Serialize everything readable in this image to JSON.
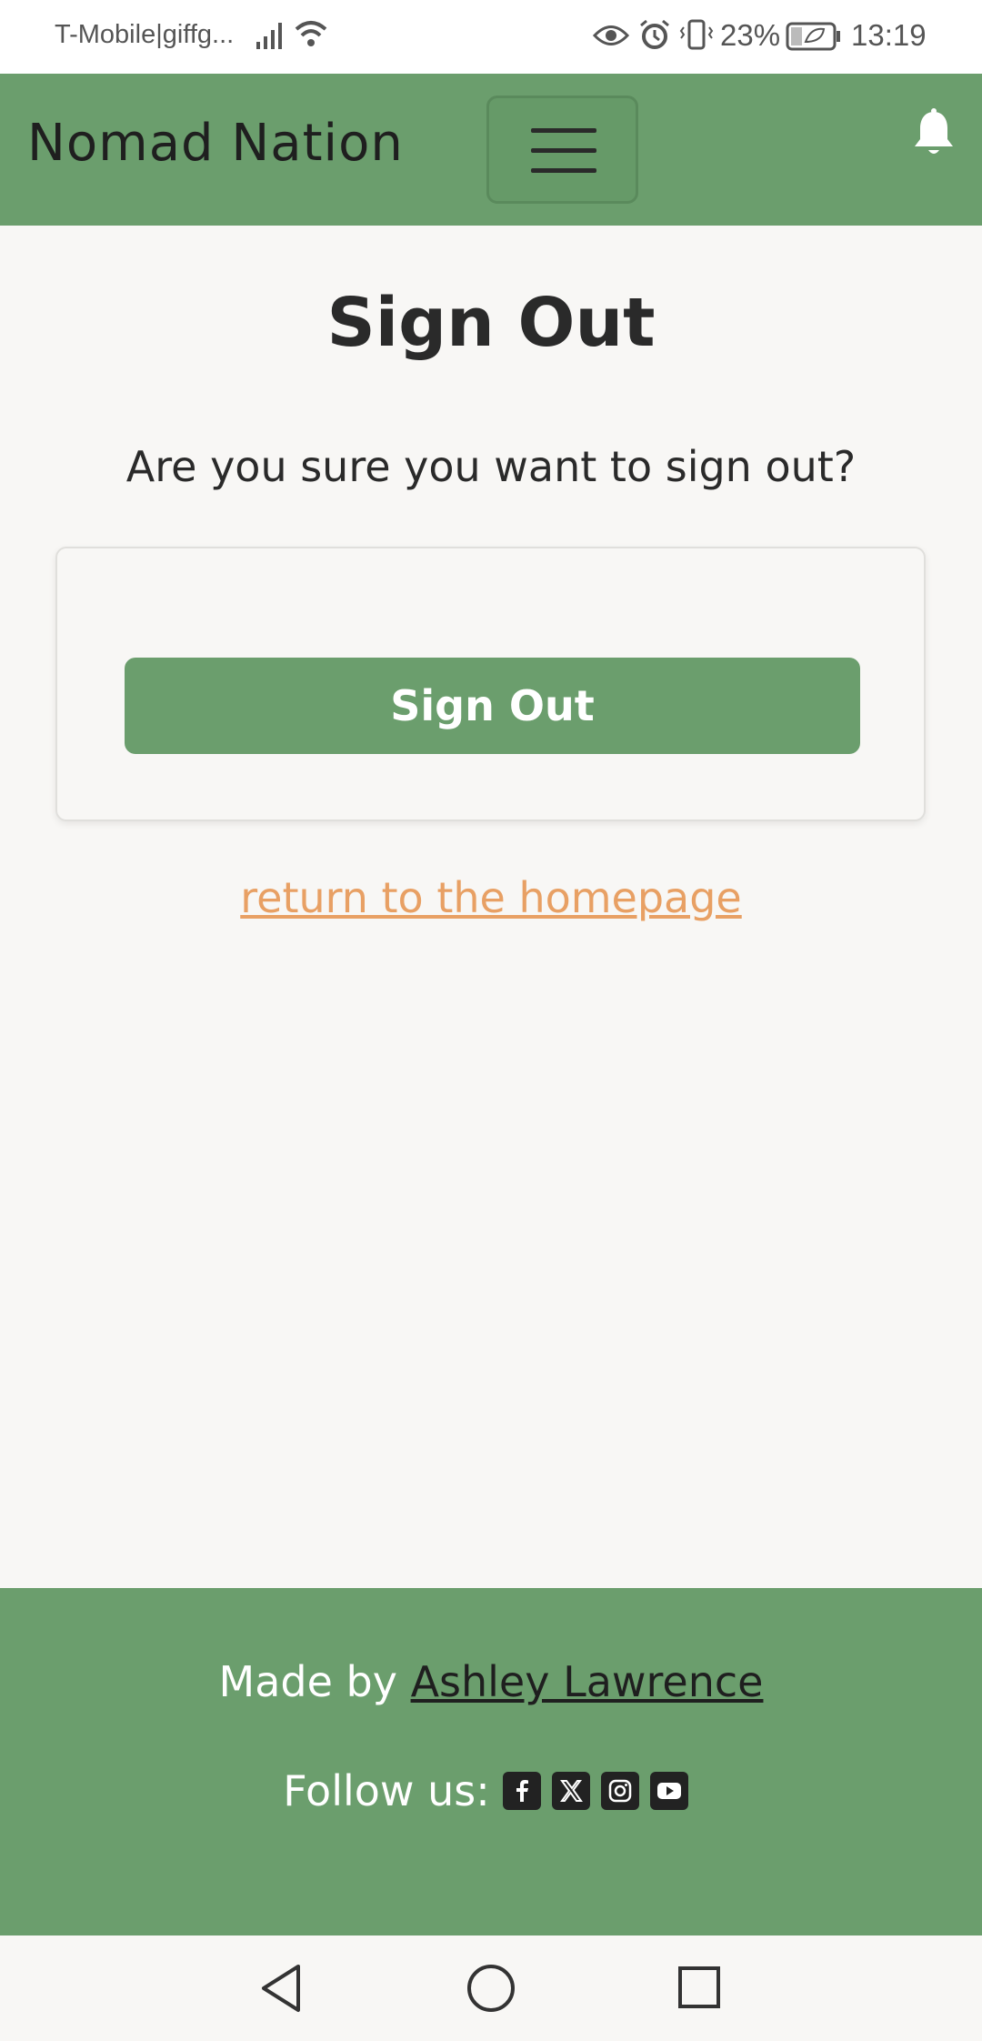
{
  "status_bar": {
    "carrier": "T-Mobile|giffg...",
    "battery_percent": "23%",
    "time": "13:19",
    "icons": [
      "signal-icon",
      "wifi-icon",
      "eye-icon",
      "alarm-icon",
      "vibrate-icon",
      "battery-icon"
    ]
  },
  "navbar": {
    "brand": "Nomad Nation",
    "menu_icon": "hamburger-menu-icon",
    "notification_icon": "bell-icon"
  },
  "main": {
    "title": "Sign Out",
    "confirm_text": "Are you sure you want to sign out?",
    "signout_button": "Sign Out",
    "home_link": "return to the homepage"
  },
  "footer": {
    "made_by_prefix": "Made by ",
    "made_by_name": "Ashley Lawrence",
    "follow_label": "Follow us:",
    "social_icons": [
      "facebook-icon",
      "x-twitter-icon",
      "instagram-icon",
      "youtube-icon"
    ]
  },
  "android_nav": {
    "icons": [
      "back-icon",
      "home-icon",
      "recent-apps-icon"
    ]
  },
  "colors": {
    "primary": "#6b9e6d",
    "link": "#e8a064",
    "background": "#f8f7f5",
    "text": "#2a2a2a"
  }
}
